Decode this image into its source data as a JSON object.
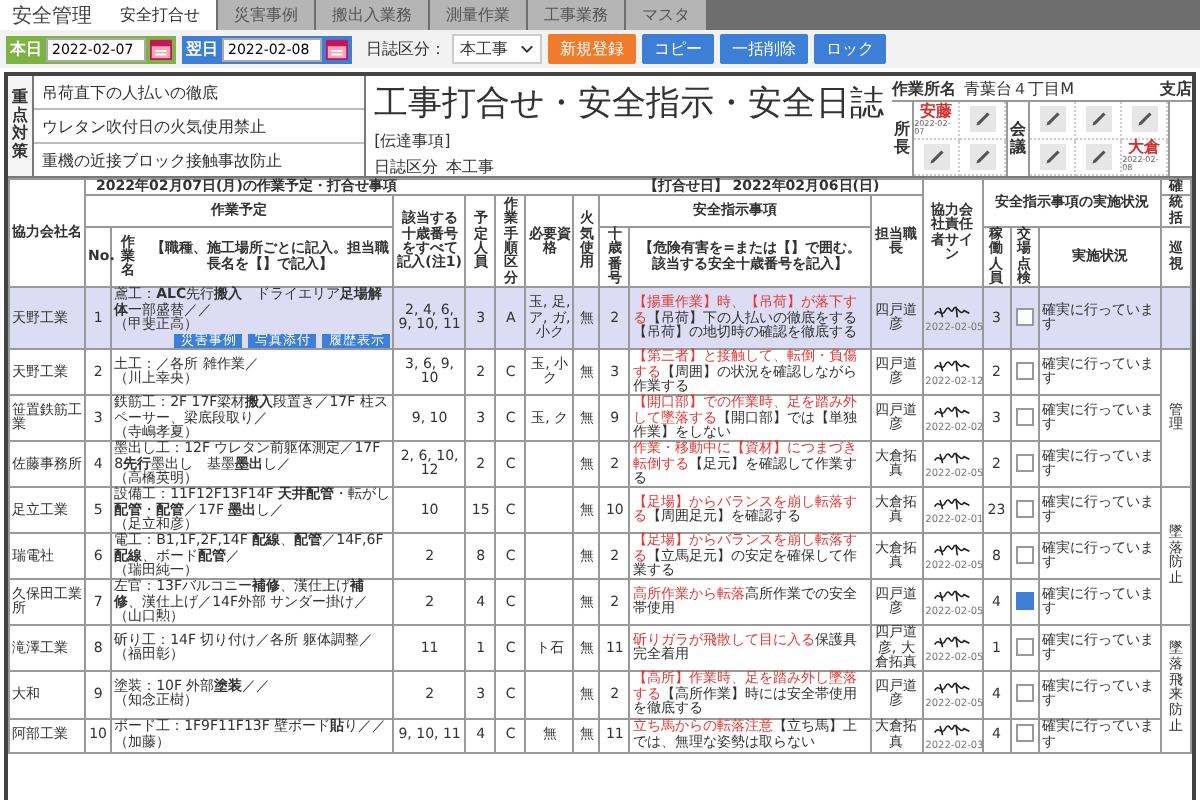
{
  "app_title": "安全管理",
  "tabs": [
    {
      "label": "安全打合せ",
      "selected": true
    },
    {
      "label": "災害事例",
      "selected": false
    },
    {
      "label": "搬出入業務",
      "selected": false
    },
    {
      "label": "測量作業",
      "selected": false
    },
    {
      "label": "工事業務",
      "selected": false
    },
    {
      "label": "マスタ",
      "selected": false
    }
  ],
  "toolbar": {
    "dates": [
      {
        "label": "本日",
        "value": "2022-02-07",
        "color": "#7cb342"
      },
      {
        "label": "翌日",
        "value": "2022-02-08",
        "color": "#3d7fd6"
      }
    ],
    "diary_label": "日誌区分：",
    "diary_value": "本工事",
    "buttons": [
      {
        "label": "新規登録",
        "kind": "accent"
      },
      {
        "label": "コピー",
        "kind": "normal"
      },
      {
        "label": "一括削除",
        "kind": "normal"
      },
      {
        "label": "ロック",
        "kind": "normal"
      }
    ]
  },
  "focus": {
    "label": "重点対策",
    "items": [
      "吊荷直下の人払いの徹底",
      "ウレタン吹付日の火気使用禁止",
      "重機の近接ブロック接触事故防止"
    ]
  },
  "title": "工事打合せ・安全指示・安全日誌",
  "notice": "[伝達事項]",
  "diary_type_label": "日誌区分",
  "diary_type": "本工事",
  "site": {
    "label": "作業所名",
    "value": "青葉台４丁目M",
    "branch": "支店"
  },
  "approvals": [
    {
      "label": "所長",
      "cells": [
        {
          "kind": "stamp",
          "name": "安藤",
          "date": "2022-02-07"
        },
        {
          "kind": "edit"
        },
        {
          "kind": "edit"
        },
        {
          "kind": "edit"
        }
      ]
    },
    {
      "label": "会議",
      "cells": [
        {
          "kind": "edit"
        },
        {
          "kind": "edit"
        },
        {
          "kind": "edit"
        },
        {
          "kind": "edit"
        },
        {
          "kind": "edit"
        },
        {
          "kind": "stamp",
          "name": "大倉",
          "date": "2022-02-08"
        }
      ]
    }
  ],
  "table": {
    "plan_date": "2022年02月07日(月)の作業予定・打合せ事項",
    "meeting_date": "【打合せ日】 2022年02月06日(日)",
    "headers": {
      "company": "協力会社名",
      "plan": "作業予定",
      "no": "No.",
      "work": "作業名",
      "work_note": "【職種、施工場所ごとに記入。担当職長名を【】で記入】",
      "targets": "該当する十歳番号をすべて記入(注1)",
      "planned": "予定人員",
      "procedure": "作業手順区分",
      "qualification": "必要資格",
      "fire": "火気使用",
      "instruction": "安全指示事項",
      "number": "十歳番号",
      "instruction_note": "【危険有害を=または【】で囲む。該当する安全十歳番号を記入】",
      "foreman": "担当職長",
      "sign": "協力会社責任者サイン",
      "status_group": "安全指示事項の実施状況",
      "workers": "稼働人員",
      "inspection": "交場点検",
      "status": "実施状況",
      "check": "確",
      "check_a": "統括",
      "check_b": "巡視"
    },
    "rows": [
      {
        "company": "天野工業",
        "no": "1",
        "work": "鳶工：**ALC**先行**搬入**　ドライエリア**足場解体**一部盛替／／",
        "lead": "（甲斐正高）",
        "buttons": [
          "災害事例",
          "写真添付",
          "履歴表示"
        ],
        "targets": "2, 4, 6, 9, 10, 11",
        "planned": "3",
        "procedure": "A",
        "qualification": "玉, 足, ア, ガ, 小ク",
        "fire": "無",
        "number": "2",
        "hazard": "【揚重作業】時、【吊荷】が落下する",
        "measure": "【吊荷】下の人払いの徹底をする【吊荷】の地切時の確認を徹底する",
        "foreman": "四戸道彦",
        "sign_date": "2022-02-05",
        "workers": "3",
        "checked": false,
        "status": "確実に行っています",
        "selected": true
      },
      {
        "company": "天野工業",
        "no": "2",
        "work": "土工：／各所 雑作業／",
        "lead": "（川上幸央）",
        "targets": "3, 6, 9, 10",
        "planned": "2",
        "procedure": "C",
        "qualification": "玉, 小ク",
        "fire": "無",
        "number": "3",
        "hazard": "【第三者】と接触して、転倒・負傷する",
        "measure": "【周囲】の状況を確認しながら作業する",
        "foreman": "四戸道彦",
        "sign_date": "2022-02-12",
        "workers": "2",
        "checked": false,
        "status": "確実に行っています",
        "selected": false
      },
      {
        "company": "笹置鉄筋工業",
        "no": "3",
        "work": "鉄筋工：2F 17F梁材**搬入**段置き／17F 柱スペーサー、梁底段取り／",
        "lead": "（寺嶋孝夏）",
        "targets": "9, 10",
        "planned": "3",
        "procedure": "C",
        "qualification": "玉, ク",
        "fire": "無",
        "number": "9",
        "hazard": "【開口部】での作業時、足を踏み外して墜落する",
        "measure": "【開口部】では【単独作業】をしない",
        "foreman": "四戸道彦",
        "sign_date": "2022-02-02",
        "workers": "3",
        "checked": false,
        "status": "確実に行っています",
        "selected": false
      },
      {
        "company": "佐藤事務所",
        "no": "4",
        "work": "墨出し工：12F ウレタン前躯体測定／17F 8**先行**墨出し　基墨**墨出**し／",
        "lead": "（高橋英明）",
        "targets": "2, 6, 10, 12",
        "planned": "2",
        "procedure": "C",
        "fire": "無",
        "number": "2",
        "hazard": "作業・移動中に【資材】につまづき転倒する",
        "measure": "【足元】を確認して作業する",
        "foreman": "大倉拓真",
        "sign_date": "2022-02-05",
        "workers": "2",
        "checked": false,
        "status": "確実に行っています",
        "selected": false
      },
      {
        "company": "足立工業",
        "no": "5",
        "work": "設備工：11F12F13F14F **天井配管**・転がし**配管**・**配管**／17F **墨出**し／",
        "lead": "（足立和彦）",
        "targets": "10",
        "planned": "15",
        "procedure": "C",
        "fire": "無",
        "number": "10",
        "hazard": "【足場】からバランスを崩し転落する",
        "measure": "【周囲足元】を確認する",
        "foreman": "大倉拓真",
        "sign_date": "2022-02-01",
        "workers": "23",
        "checked": false,
        "status": "確実に行っています",
        "selected": false
      },
      {
        "company": "瑞電社",
        "no": "6",
        "work": "電工：B1,1F,2F,14F **配線**、**配管**／14F,6F **配線**、ボード**配管**／",
        "lead": "（瑞田純一）",
        "targets": "2",
        "planned": "8",
        "procedure": "C",
        "fire": "無",
        "number": "2",
        "hazard": "【足場】からバランスを崩し転落する",
        "measure": "【立馬足元】の安定を確保して作業する",
        "foreman": "大倉拓真",
        "sign_date": "2022-02-05",
        "workers": "8",
        "checked": false,
        "status": "確実に行っています",
        "selected": false
      },
      {
        "company": "久保田工業所",
        "no": "7",
        "work": "左官：13Fバルコニー**補修**、漢仕上げ**補修**、漢仕上げ／14F外部 サンダー掛け／",
        "lead": "（山口勲）",
        "targets": "2",
        "planned": "4",
        "procedure": "C",
        "fire": "無",
        "number": "2",
        "hazard": "高所作業から転落",
        "measure": "高所作業での安全帯使用",
        "foreman": "四戸道彦",
        "sign_date": "2022-02-05",
        "workers": "4",
        "checked": true,
        "status": "確実に行っています",
        "selected": false
      },
      {
        "company": "滝澤工業",
        "no": "8",
        "work": "斫り工：14F 切り付け／各所 躯体調整／",
        "lead": "（福田彰）",
        "targets": "11",
        "planned": "1",
        "procedure": "C",
        "qualification": "ト石",
        "fire": "無",
        "number": "11",
        "hazard": "斫りガラが飛散して目に入る",
        "measure": "保護具完全着用",
        "foreman": "四戸道彦, 大倉拓真",
        "sign_date": "2022-02-05",
        "workers": "1",
        "checked": false,
        "status": "確実に行っています",
        "selected": false
      },
      {
        "company": "大和",
        "no": "9",
        "work": "塗装：10F 外部**塗装**／／",
        "lead": "（知念正樹）",
        "targets": "2",
        "planned": "3",
        "procedure": "C",
        "fire": "無",
        "number": "2",
        "hazard": "【高所】作業時、足を踏み外し墜落する",
        "measure": "【高所作業】時には安全帯使用を徹底する",
        "foreman": "四戸道彦",
        "sign_date": "2022-02-05",
        "workers": "4",
        "checked": false,
        "status": "確実に行っています",
        "selected": false
      },
      {
        "company": "阿部工業",
        "no": "10",
        "work": "ボード工：1F9F11F13F 壁ボード**貼**り／／",
        "lead": "（加藤）",
        "targets": "9, 10, 11",
        "planned": "4",
        "procedure": "C",
        "qualification": "無",
        "fire": "無",
        "number": "11",
        "hazard": "立ち馬からの転落注意",
        "measure": "【立ち馬】上では、無理な姿勢は取らない",
        "foreman": "大倉拓真",
        "sign_date": "2022-02-03",
        "workers": "4",
        "checked": false,
        "status": "確実に行っています",
        "selected": false
      }
    ],
    "check_groups": [
      {
        "label": "管理"
      },
      {
        "label": "墜落防止"
      },
      {
        "label": "墜落飛来防止"
      }
    ]
  }
}
